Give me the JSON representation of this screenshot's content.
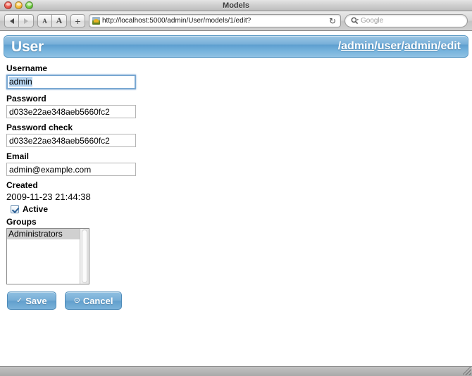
{
  "window": {
    "title": "Models",
    "controls": [
      {
        "name": "close",
        "color": "#e24b41"
      },
      {
        "name": "minimize",
        "color": "#f0b024"
      },
      {
        "name": "zoom",
        "color": "#62c134"
      }
    ]
  },
  "toolbar": {
    "back_label": "◀",
    "forward_label": "▶",
    "text_smaller_label": "A",
    "text_bigger_label": "A",
    "add_label": "+",
    "url": "http://localhost:5000/admin/User/models/1/edit?",
    "reload_label": "↻",
    "search_placeholder": "Google",
    "search_value": ""
  },
  "page_header": {
    "title": "User",
    "breadcrumb": {
      "parts": [
        {
          "sep": "/",
          "label": "admin",
          "link": true
        },
        {
          "sep": "/",
          "label": "user",
          "link": true
        },
        {
          "sep": "/",
          "label": "admin",
          "link": true
        },
        {
          "sep": "/",
          "label": "edit",
          "link": false
        }
      ]
    }
  },
  "form": {
    "username": {
      "label": "Username",
      "value": "admin",
      "focused": true,
      "selected": true
    },
    "password": {
      "label": "Password",
      "value": "d033e22ae348aeb5660fc2"
    },
    "password_check": {
      "label": "Password check",
      "value": "d033e22ae348aeb5660fc2"
    },
    "email": {
      "label": "Email",
      "value": "admin@example.com"
    },
    "created": {
      "label": "Created",
      "value": "2009-11-23 21:44:38"
    },
    "active": {
      "label": "Active",
      "checked": true
    },
    "groups": {
      "label": "Groups",
      "options": [
        "Administrators"
      ],
      "selected": "Administrators"
    }
  },
  "actions": {
    "save": {
      "label": "Save",
      "glyph": "✓"
    },
    "cancel": {
      "label": "Cancel",
      "glyph": "⊙"
    }
  },
  "colors": {
    "accent_blue": "#77aed6",
    "header_blue": "#79b0d9",
    "selection_blue": "#b6d4f0",
    "list_selection_gray": "#d0d0d0"
  }
}
